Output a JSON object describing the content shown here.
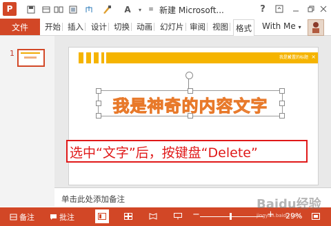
{
  "titlebar": {
    "doc_title": "新建 Microsoft...",
    "help": "?",
    "logo_letter": "P",
    "icons": [
      "powerpoint-logo-icon",
      "save-icon",
      "undo-icon",
      "redo-icon",
      "present-icon",
      "paint-icon",
      "font-icon",
      "customize-icon"
    ]
  },
  "ribbon": {
    "file": "文件",
    "tabs": [
      "开始",
      "插入",
      "设计",
      "切换",
      "动画",
      "幻灯片",
      "审阅",
      "视图",
      "格式"
    ],
    "user": "With Me",
    "user_caret": "▾"
  },
  "slides": {
    "number": "1"
  },
  "slide": {
    "header_text": "我是设置的标题",
    "header_x": "×",
    "content_text": "我是神奇的内容文字"
  },
  "annotation": {
    "text": "选中“文字”后，按键盘“Delete”"
  },
  "notes": {
    "placeholder": "单击此处添加备注"
  },
  "statusbar": {
    "notes_label": "备注",
    "comments_label": "批注",
    "zoom_minus": "−",
    "zoom_plus": "+",
    "zoom": "29%"
  },
  "watermark": {
    "text": "Baidu经验",
    "sub": "jingyan.baidu.com"
  },
  "colors": {
    "accent": "#d24726",
    "header": "#f5b400",
    "annotation": "#e01818",
    "text_outline": "#e8792a"
  }
}
